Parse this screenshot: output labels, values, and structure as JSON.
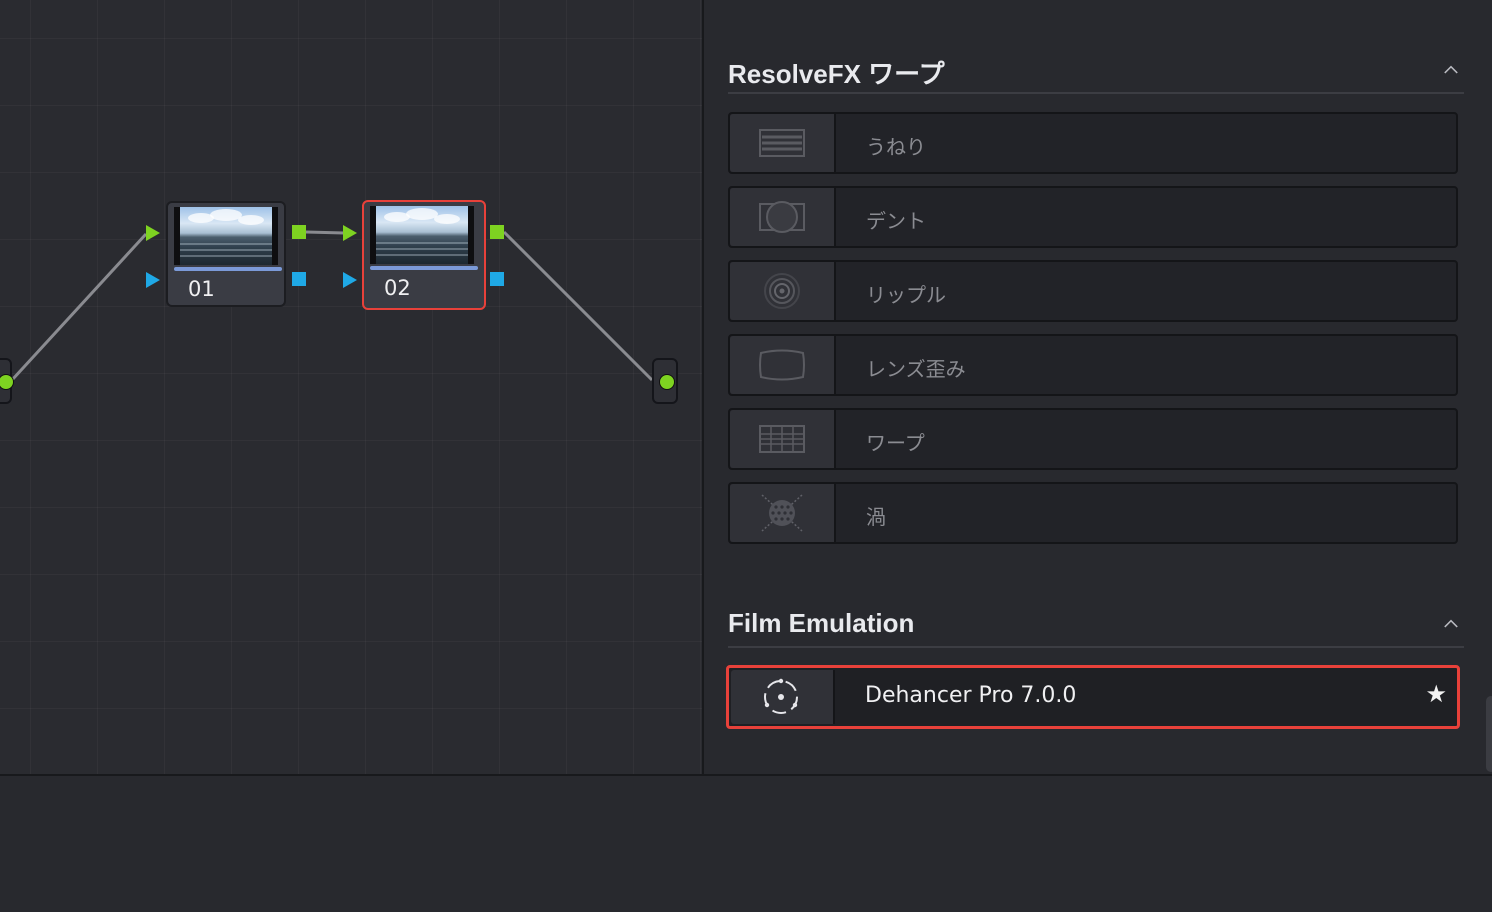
{
  "node_editor": {
    "nodes": [
      {
        "label": "01",
        "selected": false
      },
      {
        "label": "02",
        "selected": true
      }
    ],
    "colors": {
      "rgb_port": "#7ed321",
      "alpha_port": "#1fa9e6",
      "selection": "#e8413a",
      "connection": "#8a8b90"
    }
  },
  "library": {
    "sections": [
      {
        "title": "ResolveFX ワープ",
        "items": [
          {
            "label": "うねり",
            "icon": "waviness-icon"
          },
          {
            "label": "デント",
            "icon": "dent-icon"
          },
          {
            "label": "リップル",
            "icon": "ripple-icon"
          },
          {
            "label": "レンズ歪み",
            "icon": "lens-distortion-icon"
          },
          {
            "label": "ワープ",
            "icon": "warper-icon"
          },
          {
            "label": "渦",
            "icon": "vortex-icon"
          }
        ]
      },
      {
        "title": "Film Emulation",
        "items": [
          {
            "label": "Dehancer Pro 7.0.0",
            "icon": "dehancer-icon",
            "favorite": true,
            "highlighted": true
          }
        ]
      }
    ]
  }
}
